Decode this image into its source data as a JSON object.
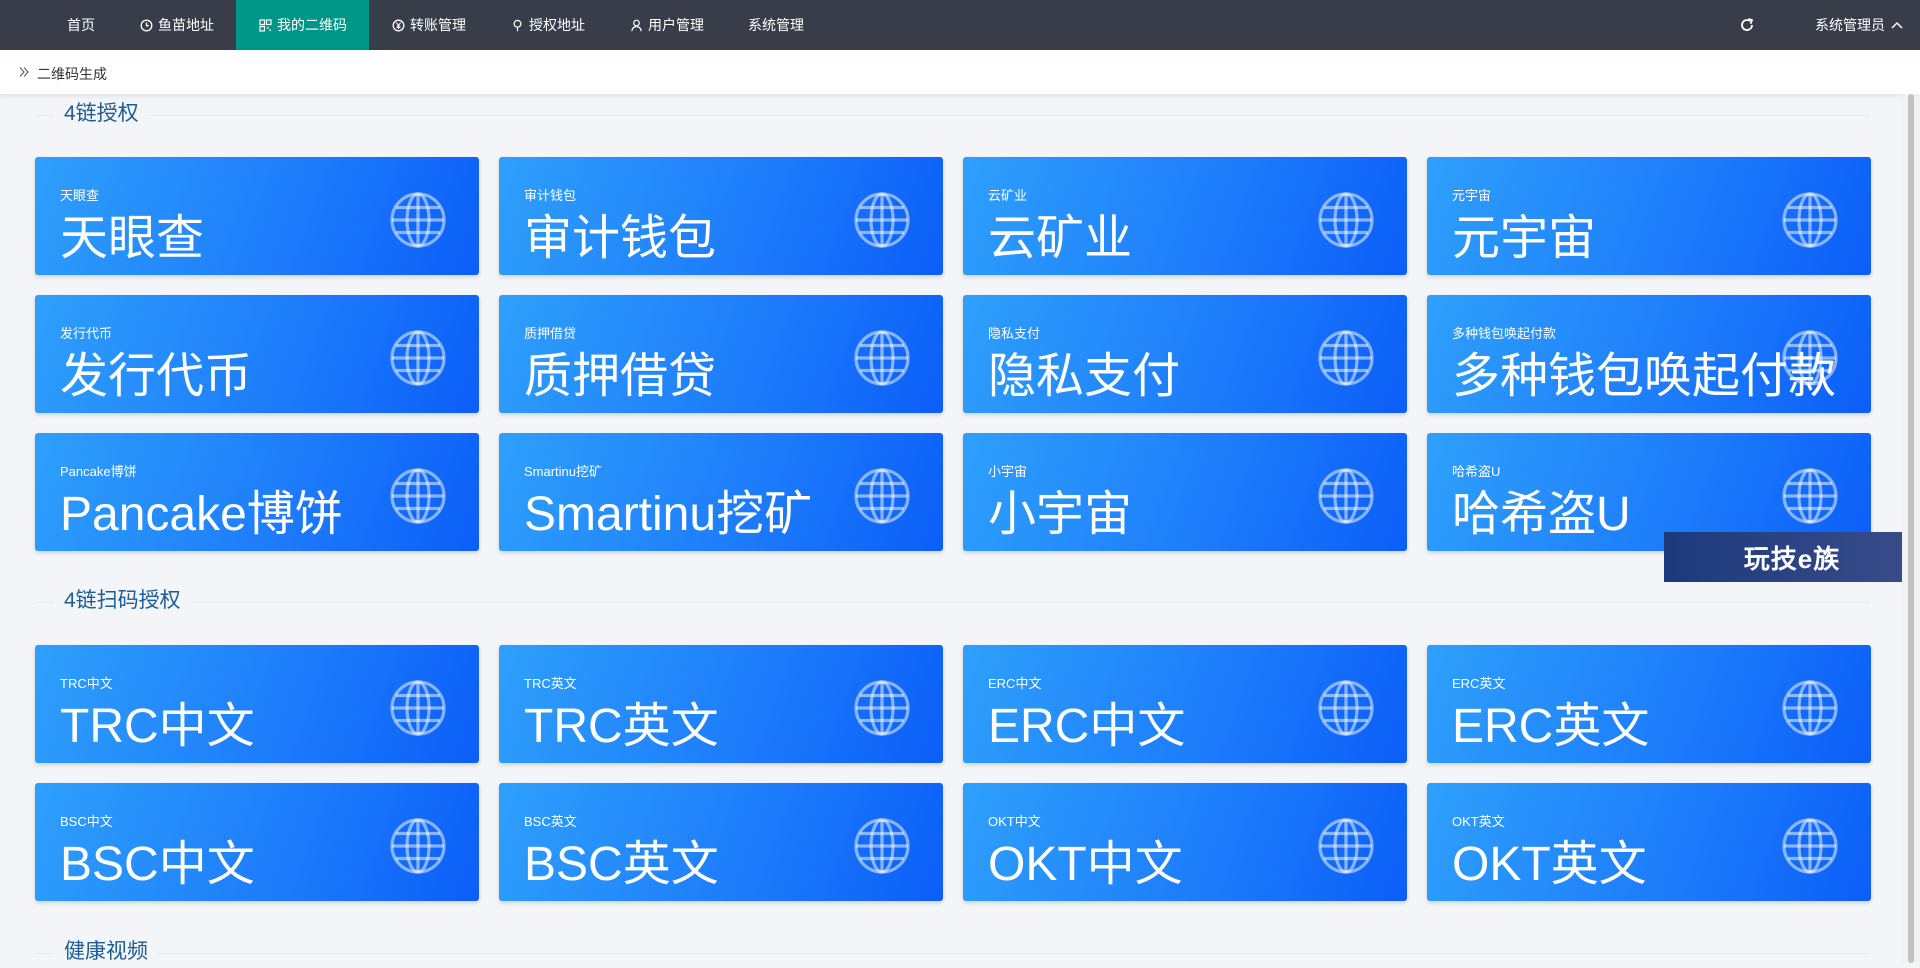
{
  "nav": {
    "items": [
      {
        "label": "首页",
        "icon": "",
        "active": false
      },
      {
        "label": "鱼苗地址",
        "icon": "clock-icon",
        "active": false
      },
      {
        "label": "我的二维码",
        "icon": "qrcode-icon",
        "active": true
      },
      {
        "label": "转账管理",
        "icon": "yen-icon",
        "active": false
      },
      {
        "label": "授权地址",
        "icon": "location-icon",
        "active": false
      },
      {
        "label": "用户管理",
        "icon": "user-icon",
        "active": false
      },
      {
        "label": "系统管理",
        "icon": "",
        "active": false
      }
    ],
    "user": "系统管理员",
    "refresh_icon": "refresh-icon"
  },
  "breadcrumb": {
    "current": "二维码生成"
  },
  "sections": [
    {
      "title": "4链授权",
      "cards": [
        {
          "small": "天眼查",
          "big": "天眼查"
        },
        {
          "small": "审计钱包",
          "big": "审计钱包"
        },
        {
          "small": "云矿业",
          "big": "云矿业"
        },
        {
          "small": "元宇宙",
          "big": "元宇宙"
        },
        {
          "small": "发行代币",
          "big": "发行代币"
        },
        {
          "small": "质押借贷",
          "big": "质押借贷"
        },
        {
          "small": "隐私支付",
          "big": "隐私支付"
        },
        {
          "small": "多种钱包唤起付款",
          "big": "多种钱包唤起付款"
        },
        {
          "small": "Pancake博饼",
          "big": "Pancake博饼"
        },
        {
          "small": "Smartinu挖矿",
          "big": "Smartinu挖矿"
        },
        {
          "small": "小宇宙",
          "big": "小宇宙"
        },
        {
          "small": "哈希盗U",
          "big": "哈希盗U"
        }
      ]
    },
    {
      "title": "4链扫码授权",
      "cards": [
        {
          "small": "TRC中文",
          "big": "TRC中文"
        },
        {
          "small": "TRC英文",
          "big": "TRC英文"
        },
        {
          "small": "ERC中文",
          "big": "ERC中文"
        },
        {
          "small": "ERC英文",
          "big": "ERC英文"
        },
        {
          "small": "BSC中文",
          "big": "BSC中文"
        },
        {
          "small": "BSC英文",
          "big": "BSC英文"
        },
        {
          "small": "OKT中文",
          "big": "OKT中文"
        },
        {
          "small": "OKT英文",
          "big": "OKT英文"
        }
      ]
    },
    {
      "title": "健康视频",
      "cards": []
    }
  ],
  "watermark": "玩技e族",
  "colors": {
    "topbar": "#393d49",
    "active_nav": "#009688",
    "card_start": "#2ea0fb",
    "card_end": "#0b5ef8",
    "section_title": "#1d5d93"
  }
}
